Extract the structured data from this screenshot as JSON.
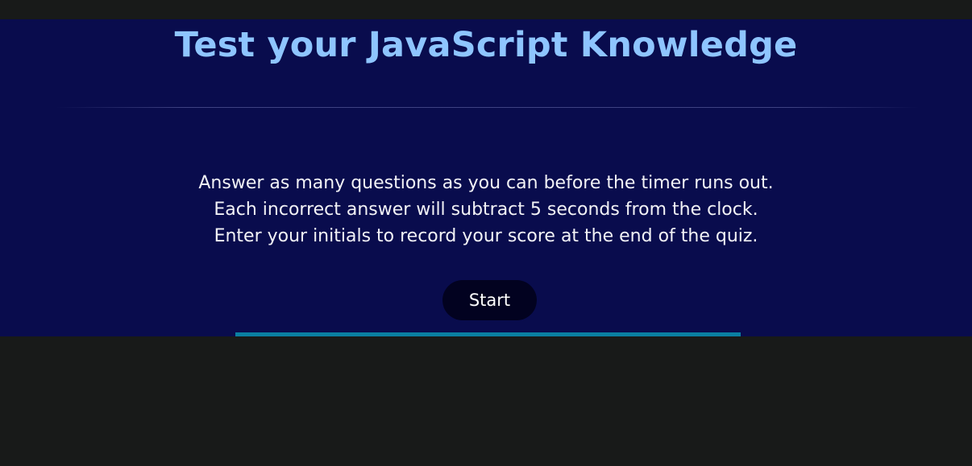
{
  "header": {
    "title": "Test your JavaScript Knowledge"
  },
  "instructions": {
    "line1": "Answer as many questions as you can before the timer runs out.",
    "line2": "Each incorrect answer will subtract 5 seconds from the clock.",
    "line3": "Enter your initials to record your score at the end of the quiz."
  },
  "controls": {
    "start_label": "Start"
  },
  "progress": {
    "fraction": 1.0
  },
  "colors": {
    "panel_background": "#090c4d",
    "page_background": "#181a19",
    "title": "#8ec5ff",
    "text": "#f2f2f6",
    "button_background": "#020220",
    "progress_bar": "#0a7fa2"
  }
}
